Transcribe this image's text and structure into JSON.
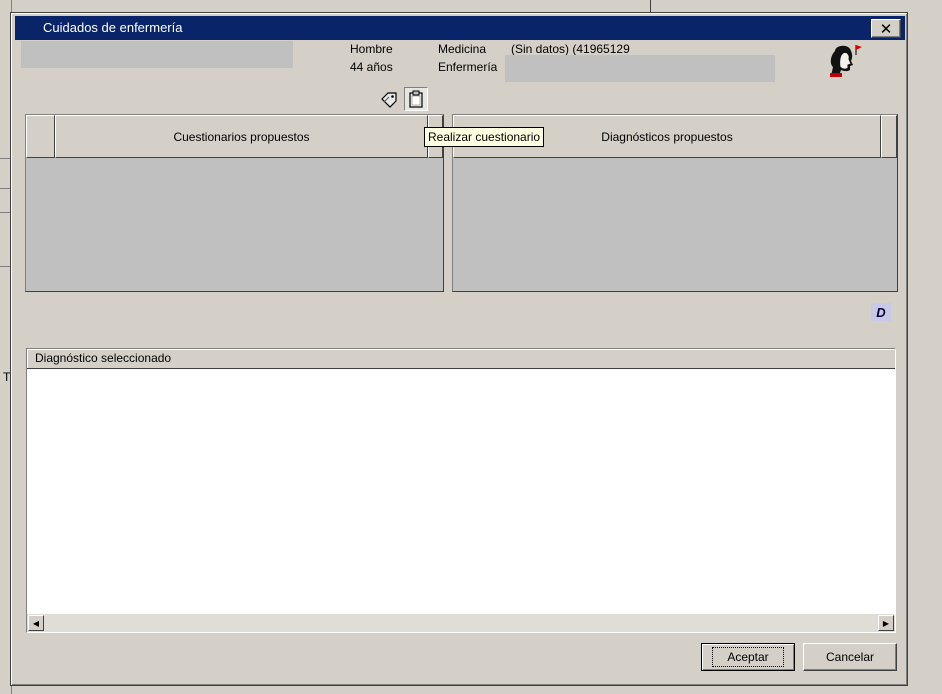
{
  "window": {
    "title": "Cuidados de enfermería",
    "close_label": "✕"
  },
  "patient": {
    "sex": "Hombre",
    "age": "44 años",
    "medicina_label": "Medicina",
    "medicina_value": "(Sin datos) (41965129",
    "enfermeria_label": "Enfermería"
  },
  "panels": {
    "left_header": "Cuestionarios propuestos",
    "right_header": "Diagnósticos propuestos"
  },
  "tooltip": "Realizar cuestionario",
  "d_icon_letter": "D",
  "list": {
    "header": "Diagnóstico seleccionado"
  },
  "buttons": {
    "accept": "Aceptar",
    "cancel": "Cancelar"
  },
  "background": {
    "partial_char": "T("
  },
  "icons": {
    "tool_1": "tag-icon",
    "tool_2": "clipboard-icon",
    "avatar": "patient-avatar-icon"
  }
}
